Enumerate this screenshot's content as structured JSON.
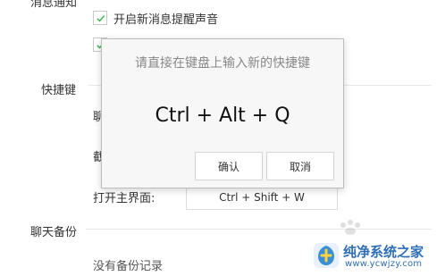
{
  "settings": {
    "section_notify_label": "消息通知",
    "checkbox_new_msg": {
      "label": "开启新消息提醒声音",
      "checked": true
    },
    "checkbox_second": {
      "checked": true
    },
    "section_shortcut_label": "快捷键",
    "shortcut_row1_partial": "聊",
    "shortcut_row2_partial": "截",
    "open_main_label": "打开主界面:",
    "open_main_value": "Ctrl + Shift + W",
    "section_backup_label": "聊天备份",
    "backup_empty_text": "没有备份记录"
  },
  "dialog": {
    "title": "请直接在键盘上输入新的快捷键",
    "combo": "Ctrl + Alt + Q",
    "ok_label": "确认",
    "cancel_label": "取消"
  },
  "watermark": {
    "site_name": "纯净系统之家",
    "url": "www.ycwjzy.com",
    "accent": "#2f6fb7"
  },
  "icons": {
    "check": "check-icon",
    "logo": "site-logo-icon"
  }
}
